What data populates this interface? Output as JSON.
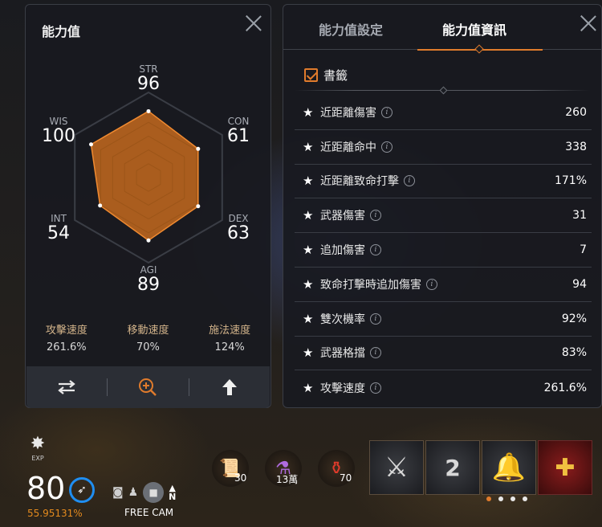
{
  "left_panel": {
    "title": "能力值",
    "stats": {
      "str": {
        "label": "STR",
        "value": "96"
      },
      "con": {
        "label": "CON",
        "value": "61"
      },
      "dex": {
        "label": "DEX",
        "value": "63"
      },
      "agi": {
        "label": "AGI",
        "value": "89"
      },
      "int": {
        "label": "INT",
        "value": "54"
      },
      "wis": {
        "label": "WIS",
        "value": "100"
      }
    },
    "radar_levels": {
      "str": 0.96,
      "con": 0.83,
      "dex": 0.83,
      "agi": 0.91,
      "int": 0.81,
      "wis": 0.96
    },
    "speeds": [
      {
        "label": "攻擊速度",
        "value": "261.6%"
      },
      {
        "label": "移動速度",
        "value": "70%"
      },
      {
        "label": "施法速度",
        "value": "124%"
      }
    ],
    "icons": {
      "swap": "swap-icon",
      "zoom": "zoom-in-icon",
      "up": "arrow-up-icon"
    },
    "accent": "#e07b2c"
  },
  "right_panel": {
    "tabs": [
      {
        "label": "能力值設定"
      },
      {
        "label": "能力值資訊"
      }
    ],
    "bookmark_label": "書籤",
    "rows": [
      {
        "name": "近距離傷害",
        "value": "260"
      },
      {
        "name": "近距離命中",
        "value": "338"
      },
      {
        "name": "近距離致命打擊",
        "value": "171%"
      },
      {
        "name": "武器傷害",
        "value": "31"
      },
      {
        "name": "追加傷害",
        "value": "7"
      },
      {
        "name": "致命打擊時追加傷害",
        "value": "94"
      },
      {
        "name": "雙次機率",
        "value": "92%"
      },
      {
        "name": "武器格擋",
        "value": "83%"
      },
      {
        "name": "攻擊速度",
        "value": "261.6%"
      }
    ]
  },
  "hud": {
    "exp_label": "EXP",
    "level": "80",
    "exp_percent": "55.95131%",
    "freecam_label": "FREE CAM",
    "compass": "N",
    "items": [
      {
        "qty": "30",
        "icon": "scroll-icon"
      },
      {
        "qty": "13萬",
        "icon": "potion-vial-icon"
      },
      {
        "qty": "70",
        "icon": "red-potion-icon"
      }
    ],
    "skill_2_count": "2"
  }
}
